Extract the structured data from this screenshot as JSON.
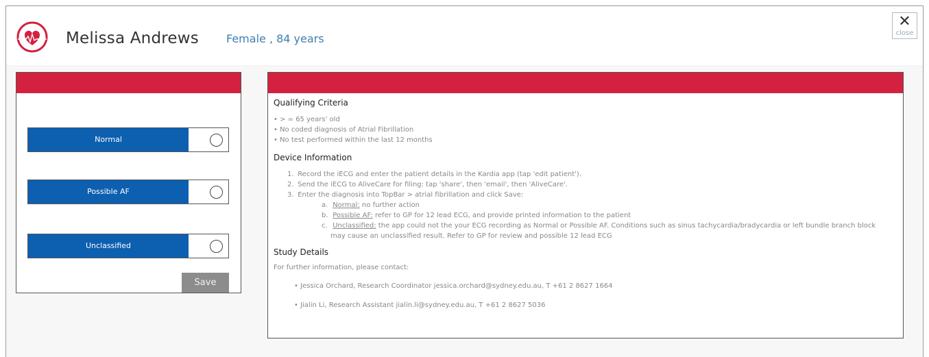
{
  "patient": {
    "name": "Melissa Andrews",
    "info": "Female , 84 years"
  },
  "close": {
    "icon": "✕",
    "label": "close"
  },
  "options": [
    {
      "label": "Normal"
    },
    {
      "label": "Possible AF"
    },
    {
      "label": "Unclassified"
    }
  ],
  "save_label": "Save",
  "qualifying": {
    "title": "Qualifying Criteria",
    "items": [
      "• > = 65 years' old",
      "• No coded diagnosis of Atrial Fibrillation",
      "• No test performed within the last 12 months"
    ]
  },
  "device": {
    "title": "Device Information",
    "steps": [
      {
        "num": "1.",
        "text": "Record the iECG and enter the patient details in the Kardia app (tap 'edit patient')."
      },
      {
        "num": "2.",
        "text": "Send the iECG to AliveCare for filing: tap 'share', then 'email', then 'AliveCare'."
      },
      {
        "num": "3.",
        "text": "Enter the diagnosis into TopBar > atrial fibrillation and click Save:"
      }
    ],
    "substeps": [
      {
        "letter": "a.",
        "term": "Normal:",
        "text": " no further action"
      },
      {
        "letter": "b.",
        "term": "Possible AF:",
        "text": " refer to GP for 12 lead ECG, and provide printed information to the patient"
      },
      {
        "letter": "c.",
        "term": "Unclassified:",
        "text": " the app could not the your ECG recording as Normal or Possible AF. Conditions such as sinus tachycardia/bradycardia or left bundle branch block",
        "continuation": "may cause an unclassified result. Refer to GP for review and possible 12 lead ECG"
      }
    ]
  },
  "study": {
    "title": "Study Details",
    "intro": "For further information, please contact:",
    "contacts": [
      "• Jessica Orchard, Research Coordinator jessica.orchard@sydney.edu.au, T +61 2 8627 1664",
      "• Jialin Li, Research Assistant jialin.li@sydney.edu.au, T +61 2 8627 5036"
    ]
  },
  "colors": {
    "accent_red": "#d3213f",
    "option_blue": "#0d5fb0",
    "name_blue": "#3e7fb0",
    "save_grey": "#8c8c8c"
  }
}
